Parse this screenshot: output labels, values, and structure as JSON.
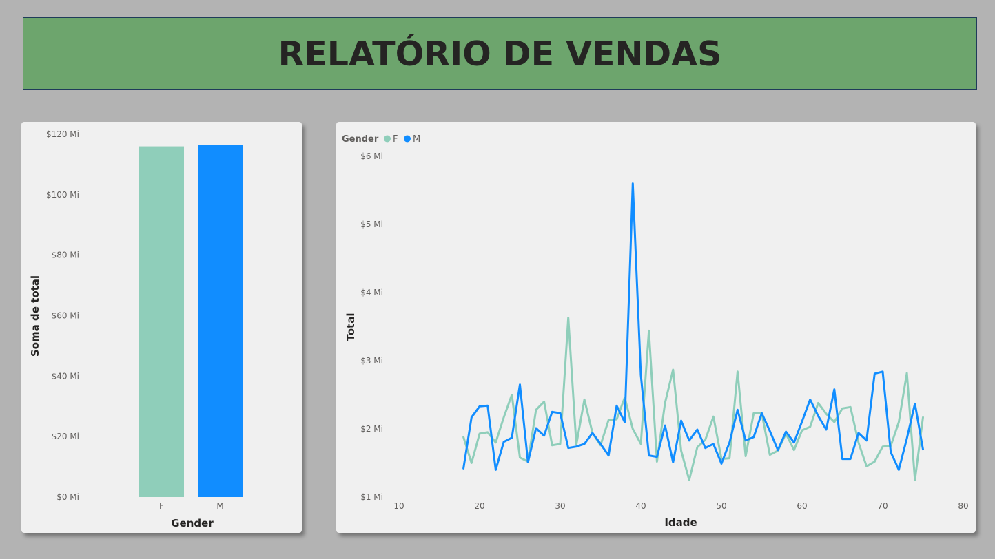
{
  "header": {
    "title": "RELATÓRIO DE VENDAS"
  },
  "colors": {
    "F": "#8fceba",
    "M": "#118dff",
    "background": "#b3b3b3",
    "header": "#6da56d",
    "card": "#f0f0f0"
  },
  "chart_data": [
    {
      "type": "bar",
      "title": "",
      "xlabel": "Gender",
      "ylabel": "Soma de total",
      "categories": [
        "F",
        "M"
      ],
      "values": [
        116.0,
        116.5
      ],
      "ylim": [
        0,
        120
      ],
      "yticks": [
        "$0 Mi",
        "$20 Mi",
        "$40 Mi",
        "$60 Mi",
        "$80 Mi",
        "$100 Mi",
        "$120 Mi"
      ],
      "grid": false
    },
    {
      "type": "line",
      "title": "",
      "xlabel": "Idade",
      "ylabel": "Total",
      "legend_title": "Gender",
      "legend_position": "top-left",
      "xlim": [
        10,
        80
      ],
      "ylim": [
        1,
        6
      ],
      "xticks": [
        "10",
        "20",
        "30",
        "40",
        "50",
        "60",
        "70",
        "80"
      ],
      "yticks": [
        "$1 Mi",
        "$2 Mi",
        "$3 Mi",
        "$4 Mi",
        "$5 Mi",
        "$6 Mi"
      ],
      "grid": false,
      "x": [
        18,
        19,
        20,
        21,
        22,
        23,
        24,
        25,
        26,
        27,
        28,
        29,
        30,
        31,
        32,
        33,
        34,
        35,
        36,
        37,
        38,
        39,
        40,
        41,
        42,
        43,
        44,
        45,
        46,
        47,
        48,
        49,
        50,
        51,
        52,
        53,
        54,
        55,
        56,
        57,
        58,
        59,
        60,
        61,
        62,
        63,
        64,
        65,
        66,
        67,
        68,
        69,
        70,
        71,
        72,
        73,
        74,
        75
      ],
      "series": [
        {
          "name": "F",
          "values": [
            1.88,
            1.5,
            1.93,
            1.95,
            1.8,
            2.17,
            2.5,
            1.58,
            1.52,
            2.28,
            2.4,
            1.76,
            1.78,
            3.63,
            1.77,
            2.43,
            1.94,
            1.76,
            2.13,
            2.14,
            2.46,
            2.0,
            1.78,
            3.44,
            1.52,
            2.38,
            2.87,
            1.68,
            1.25,
            1.73,
            1.84,
            2.18,
            1.56,
            1.57,
            2.84,
            1.6,
            2.23,
            2.23,
            1.62,
            1.68,
            1.93,
            1.69,
            1.98,
            2.03,
            2.38,
            2.22,
            2.1,
            2.3,
            2.32,
            1.8,
            1.45,
            1.52,
            1.74,
            1.75,
            2.1,
            2.82,
            1.25,
            2.17
          ]
        },
        {
          "name": "M",
          "values": [
            1.42,
            2.17,
            2.33,
            2.34,
            1.4,
            1.81,
            1.87,
            2.65,
            1.51,
            2.01,
            1.9,
            2.25,
            2.23,
            1.72,
            1.74,
            1.78,
            1.94,
            1.78,
            1.61,
            2.34,
            2.1,
            5.6,
            2.79,
            1.61,
            1.59,
            2.05,
            1.51,
            2.12,
            1.83,
            1.99,
            1.72,
            1.78,
            1.49,
            1.8,
            2.28,
            1.83,
            1.88,
            2.23,
            1.97,
            1.69,
            1.96,
            1.8,
            2.11,
            2.43,
            2.19,
            1.99,
            2.58,
            1.56,
            1.56,
            1.94,
            1.83,
            2.81,
            2.84,
            1.66,
            1.4,
            1.86,
            2.37,
            1.7
          ]
        }
      ]
    }
  ]
}
